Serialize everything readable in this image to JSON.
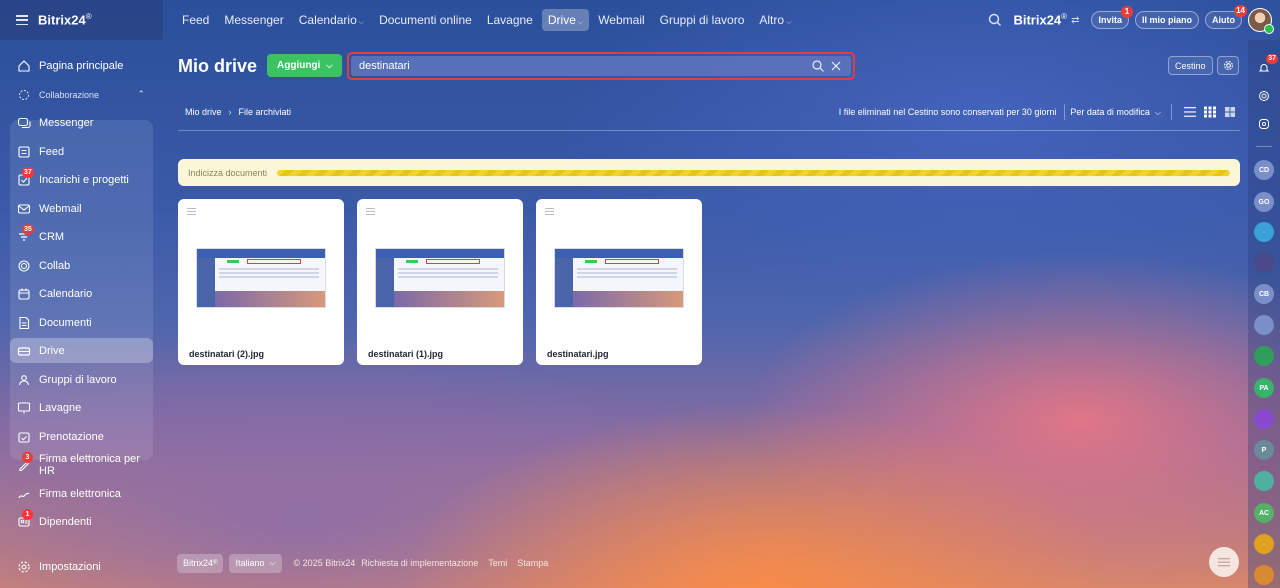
{
  "brand": {
    "name": "Bitrix24",
    "mark": "®"
  },
  "topnav": [
    {
      "label": "Feed",
      "active": false,
      "caret": false
    },
    {
      "label": "Messenger",
      "active": false,
      "caret": false
    },
    {
      "label": "Calendario",
      "active": false,
      "caret": true
    },
    {
      "label": "Documenti online",
      "active": false,
      "caret": false
    },
    {
      "label": "Lavagne",
      "active": false,
      "caret": false
    },
    {
      "label": "Drive",
      "active": true,
      "caret": true
    },
    {
      "label": "Webmail",
      "active": false,
      "caret": false
    },
    {
      "label": "Gruppi di lavoro",
      "active": false,
      "caret": false
    },
    {
      "label": "Altro",
      "active": false,
      "caret": true
    }
  ],
  "topright": {
    "brand": "Bitrix24",
    "invite": {
      "label": "Invita",
      "badge": "1"
    },
    "plan": {
      "label": "Il mio piano"
    },
    "help": {
      "label": "Aiuto",
      "badge": "14"
    }
  },
  "sidebar": {
    "items": [
      {
        "label": "Pagina principale",
        "icon": "home-icon",
        "badge": ""
      },
      {
        "label": "Collaborazione",
        "icon": "collab-group-icon",
        "badge": ""
      },
      {
        "label": "Messenger",
        "icon": "chat-icon",
        "badge": ""
      },
      {
        "label": "Feed",
        "icon": "feed-icon",
        "badge": ""
      },
      {
        "label": "Incarichi e progetti",
        "icon": "tasks-icon",
        "badge": "37"
      },
      {
        "label": "Webmail",
        "icon": "mail-icon",
        "badge": ""
      },
      {
        "label": "CRM",
        "icon": "crm-icon",
        "badge": "35"
      },
      {
        "label": "Collab",
        "icon": "collab-icon",
        "badge": ""
      },
      {
        "label": "Calendario",
        "icon": "calendar-icon",
        "badge": ""
      },
      {
        "label": "Documenti",
        "icon": "documents-icon",
        "badge": ""
      },
      {
        "label": "Drive",
        "icon": "drive-icon",
        "badge": ""
      },
      {
        "label": "Gruppi di lavoro",
        "icon": "groups-icon",
        "badge": ""
      },
      {
        "label": "Lavagne",
        "icon": "boards-icon",
        "badge": ""
      },
      {
        "label": "Prenotazione",
        "icon": "booking-icon",
        "badge": ""
      },
      {
        "label": "Firma elettronica per HR",
        "icon": "hr-sign-icon",
        "badge": "3"
      },
      {
        "label": "Firma elettronica",
        "icon": "sign-icon",
        "badge": ""
      },
      {
        "label": "Dipendenti",
        "icon": "employees-icon",
        "badge": "1"
      },
      {
        "label": "Impostazioni",
        "icon": "settings-icon",
        "badge": ""
      }
    ]
  },
  "main": {
    "title": "Mio drive",
    "add_label": "Aggiungi",
    "search": {
      "value": "destinatari",
      "placeholder": ""
    },
    "trash_label": "Cestino",
    "breadcrumb": [
      "Mio drive",
      "File archiviati"
    ],
    "retention_note": "I file eliminati nel Cestino sono conservati per 30 giorni",
    "sort_label": "Per data di modifica",
    "indexing_label": "Indicizza documenti",
    "files": [
      {
        "name": "destinatari (2).jpg"
      },
      {
        "name": "destinatari (1).jpg"
      },
      {
        "name": "destinatari.jpg"
      }
    ]
  },
  "footer": {
    "brand": "Bitrix24",
    "language": "Italiano",
    "copyright": "© 2025 Bitrix24",
    "links": [
      "Richiesta di implementazione",
      "Temi",
      "Stampa"
    ]
  },
  "right_rail": {
    "notifications_badge": "37",
    "avatars": [
      "CD",
      "GO",
      "",
      "",
      "CB",
      "",
      "",
      "PA",
      "",
      "P",
      "",
      "AC",
      "",
      ""
    ]
  },
  "colors": {
    "accent_green": "#3bc363",
    "badge_red": "#ef3a3a",
    "search_highlight": "#e83b3b",
    "index_bar": "#fbf6d8"
  }
}
